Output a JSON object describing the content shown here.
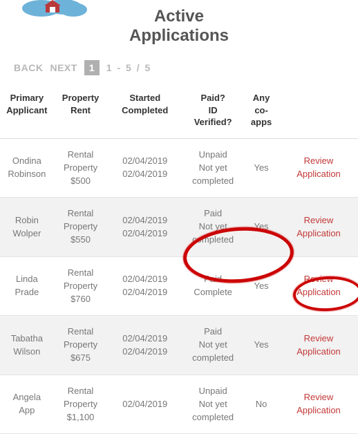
{
  "header": {
    "title_line1": "Active",
    "title_line2": "Applications"
  },
  "pagination": {
    "back_label": "BACK",
    "next_label": "NEXT",
    "current_page": "1",
    "range_text": "1 - 5  /  5"
  },
  "table": {
    "headers": {
      "applicant_l1": "Primary",
      "applicant_l2": "Applicant",
      "property_l1": "Property",
      "property_l2": "Rent",
      "started_l1": "Started",
      "started_l2": "Completed",
      "paid_l1": "Paid?",
      "paid_l2": "ID",
      "paid_l3": "Verified?",
      "coapps_l1": "Any",
      "coapps_l2": "co-",
      "coapps_l3": "apps",
      "action": ""
    },
    "rows": [
      {
        "applicant_l1": "Ondina",
        "applicant_l2": "Robinson",
        "property_l1": "Rental",
        "property_l2": "Property",
        "property_l3": "$500",
        "started_l1": "02/04/2019",
        "started_l2": "02/04/2019",
        "paid_l1": "Unpaid",
        "paid_l2": "Not yet",
        "paid_l3": "completed",
        "coapps": "Yes",
        "action_l1": "Review",
        "action_l2": "Application"
      },
      {
        "applicant_l1": "Robin",
        "applicant_l2": "Wolper",
        "property_l1": "Rental",
        "property_l2": "Property",
        "property_l3": "$550",
        "started_l1": "02/04/2019",
        "started_l2": "02/04/2019",
        "paid_l1": "Paid",
        "paid_l2": "Not yet",
        "paid_l3": "completed",
        "coapps": "Yes",
        "action_l1": "Review",
        "action_l2": "Application"
      },
      {
        "applicant_l1": "Linda",
        "applicant_l2": "Prade",
        "property_l1": "Rental",
        "property_l2": "Property",
        "property_l3": "$760",
        "started_l1": "02/04/2019",
        "started_l2": "02/04/2019",
        "paid_l1": "Paid",
        "paid_l2": "Complete",
        "paid_l3": "",
        "coapps": "Yes",
        "action_l1": "Review",
        "action_l2": "Application"
      },
      {
        "applicant_l1": "Tabatha",
        "applicant_l2": "Wilson",
        "property_l1": "Rental",
        "property_l2": "Property",
        "property_l3": "$675",
        "started_l1": "02/04/2019",
        "started_l2": "02/04/2019",
        "paid_l1": "Paid",
        "paid_l2": "Not yet",
        "paid_l3": "completed",
        "coapps": "Yes",
        "action_l1": "Review",
        "action_l2": "Application"
      },
      {
        "applicant_l1": "Angela",
        "applicant_l2": "App",
        "property_l1": "Rental",
        "property_l2": "Property",
        "property_l3": "$1,100",
        "started_l1": "02/04/2019",
        "started_l2": "",
        "paid_l1": "Unpaid",
        "paid_l2": "Not yet",
        "paid_l3": "completed",
        "coapps": "No",
        "action_l1": "Review",
        "action_l2": "Application"
      }
    ]
  }
}
